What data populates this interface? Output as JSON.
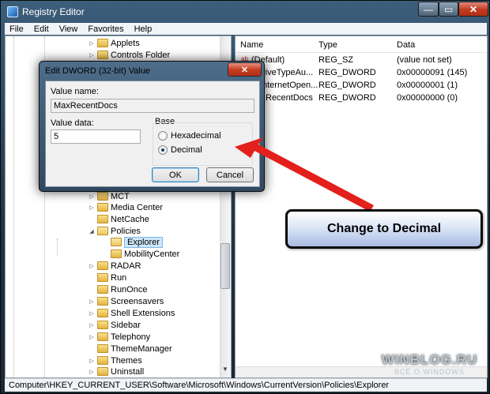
{
  "window": {
    "title": "Registry Editor",
    "min": "—",
    "max": "▭",
    "close": "✕"
  },
  "menu": [
    "File",
    "Edit",
    "View",
    "Favorites",
    "Help"
  ],
  "tree": {
    "top": [
      {
        "label": "Applets"
      },
      {
        "label": "Controls Folder"
      }
    ],
    "bottom": [
      {
        "label": "MCT"
      },
      {
        "label": "Media Center"
      },
      {
        "label": "NetCache"
      },
      {
        "label": "Policies"
      },
      {
        "label": "Explorer"
      },
      {
        "label": "MobilityCenter"
      },
      {
        "label": "RADAR"
      },
      {
        "label": "Run"
      },
      {
        "label": "RunOnce"
      },
      {
        "label": "Screensavers"
      },
      {
        "label": "Shell Extensions"
      },
      {
        "label": "Sidebar"
      },
      {
        "label": "Telephony"
      },
      {
        "label": "ThemeManager"
      },
      {
        "label": "Themes"
      },
      {
        "label": "Uninstall"
      }
    ]
  },
  "list": {
    "columns": {
      "name": "Name",
      "type": "Type",
      "data": "Data"
    },
    "rows": [
      {
        "name": "(Default)",
        "type": "REG_SZ",
        "data": "(value not set)",
        "icon": "ab"
      },
      {
        "name": "riveTypeAu...",
        "type": "REG_DWORD",
        "data": "0x00000091 (145)",
        "icon": ""
      },
      {
        "name": "nternetOpen...",
        "type": "REG_DWORD",
        "data": "0x00000001 (1)",
        "icon": ""
      },
      {
        "name": "RecentDocs",
        "type": "REG_DWORD",
        "data": "0x00000000 (0)",
        "icon": ""
      }
    ]
  },
  "status": "Computer\\HKEY_CURRENT_USER\\Software\\Microsoft\\Windows\\CurrentVersion\\Policies\\Explorer",
  "dialog": {
    "title": "Edit DWORD (32-bit) Value",
    "close": "✕",
    "value_name_label": "Value name:",
    "value_name": "MaxRecentDocs",
    "value_data_label": "Value data:",
    "value_data": "5",
    "base_label": "Base",
    "hex_label": "Hexadecimal",
    "dec_label": "Decimal",
    "selected_base": "Decimal",
    "ok": "OK",
    "cancel": "Cancel"
  },
  "callout": "Change to Decimal",
  "watermark": {
    "line1": "WINBLOG.RU",
    "line2": "ВСЁ О WINDOWS"
  },
  "colors": {
    "arrow": "#e3201b",
    "selection": "#cde6fb"
  }
}
